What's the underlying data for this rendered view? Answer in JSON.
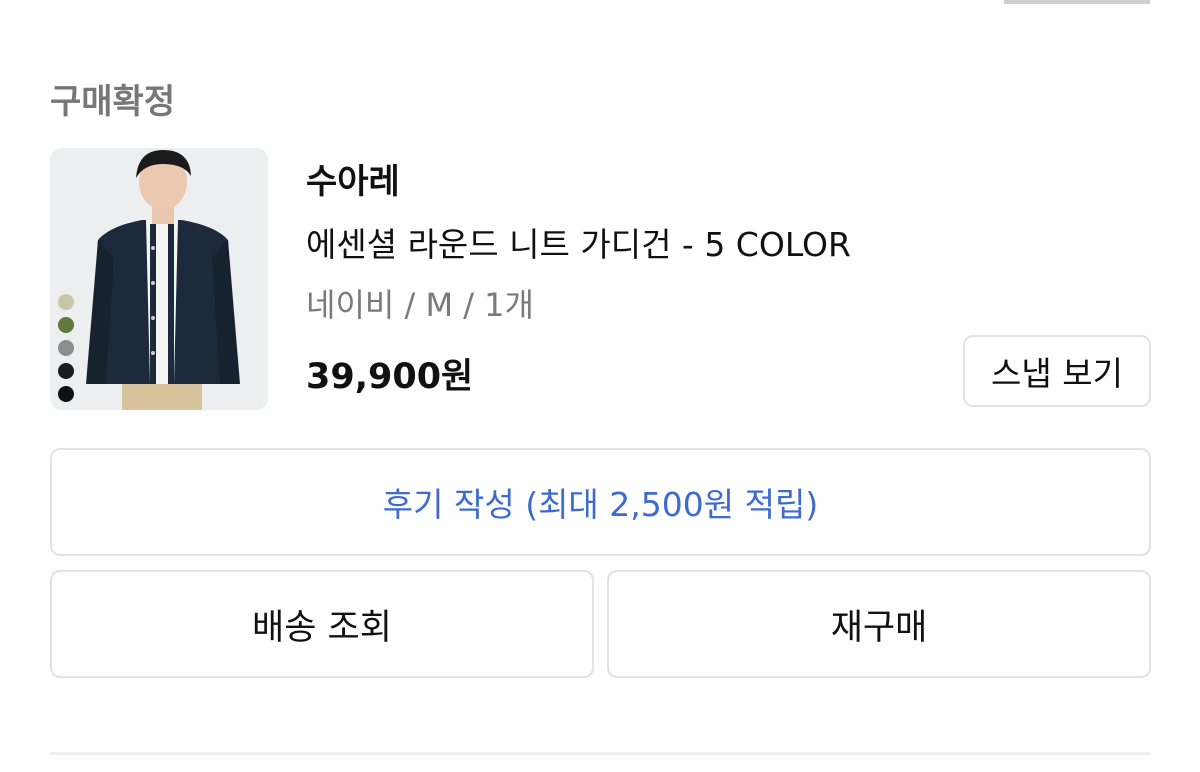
{
  "order": {
    "status": "구매확정",
    "product": {
      "brand": "수아레",
      "name": "에센셜 라운드 니트 가디건 - 5 COLOR",
      "option": "네이비 / M / 1개",
      "price": "39,900원",
      "color_swatches": [
        "#c9c5a8",
        "#5f7a3a",
        "#8a8f8c",
        "#1b1d22",
        "#111111"
      ]
    },
    "buttons": {
      "snap": "스냅 보기",
      "review": "후기 작성 (최대 2,500원 적립)",
      "shipping": "배송 조회",
      "rebuy": "재구매"
    }
  },
  "colors": {
    "accent_blue": "#3d6bd0",
    "muted_text": "#777777",
    "border": "#e2e2e2"
  }
}
